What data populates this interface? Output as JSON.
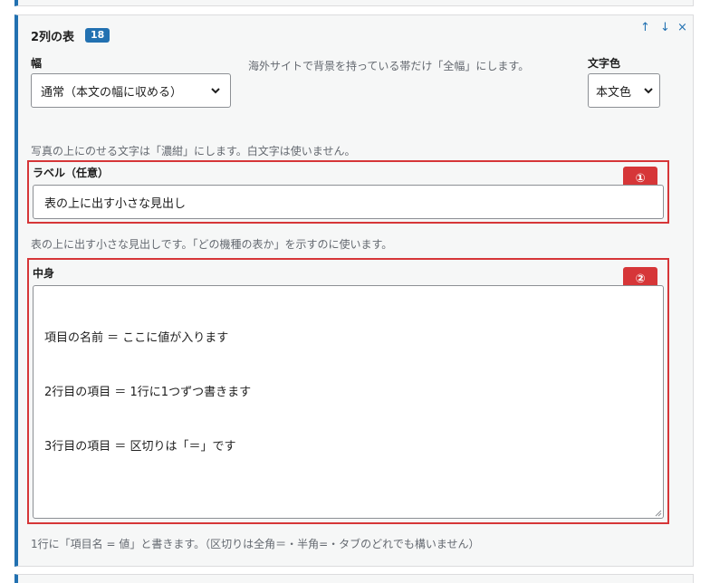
{
  "block": {
    "title": "2列の表",
    "count": "18",
    "controls": {
      "up": "↑",
      "down": "↓",
      "close": "×"
    }
  },
  "width_field": {
    "label": "幅",
    "value": "通常（本文の幅に収める）",
    "description": "海外サイトで背景を持っている帯だけ「全幅」にします。"
  },
  "color_field": {
    "label": "文字色",
    "value": "本文色"
  },
  "photo_note": "写真の上にのせる文字は「濃紺」にします。白文字は使いません。",
  "label_field": {
    "label": "ラベル（任意）",
    "value": "表の上に出す小さな見出し",
    "badge": "①",
    "description": "表の上に出す小さな見出しです。「どの機種の表か」を示すのに使います。"
  },
  "content_field": {
    "label": "中身",
    "badge": "②",
    "lines": [
      "項目の名前 ＝ ここに値が入ります",
      "2行目の項目 ＝ 1行に1つずつ書きます",
      "3行目の項目 ＝ 区切りは「＝」です"
    ],
    "description": "1行に「項目名 = 値」と書きます。（区切りは全角＝・半角=・タブのどれでも構いません）"
  }
}
